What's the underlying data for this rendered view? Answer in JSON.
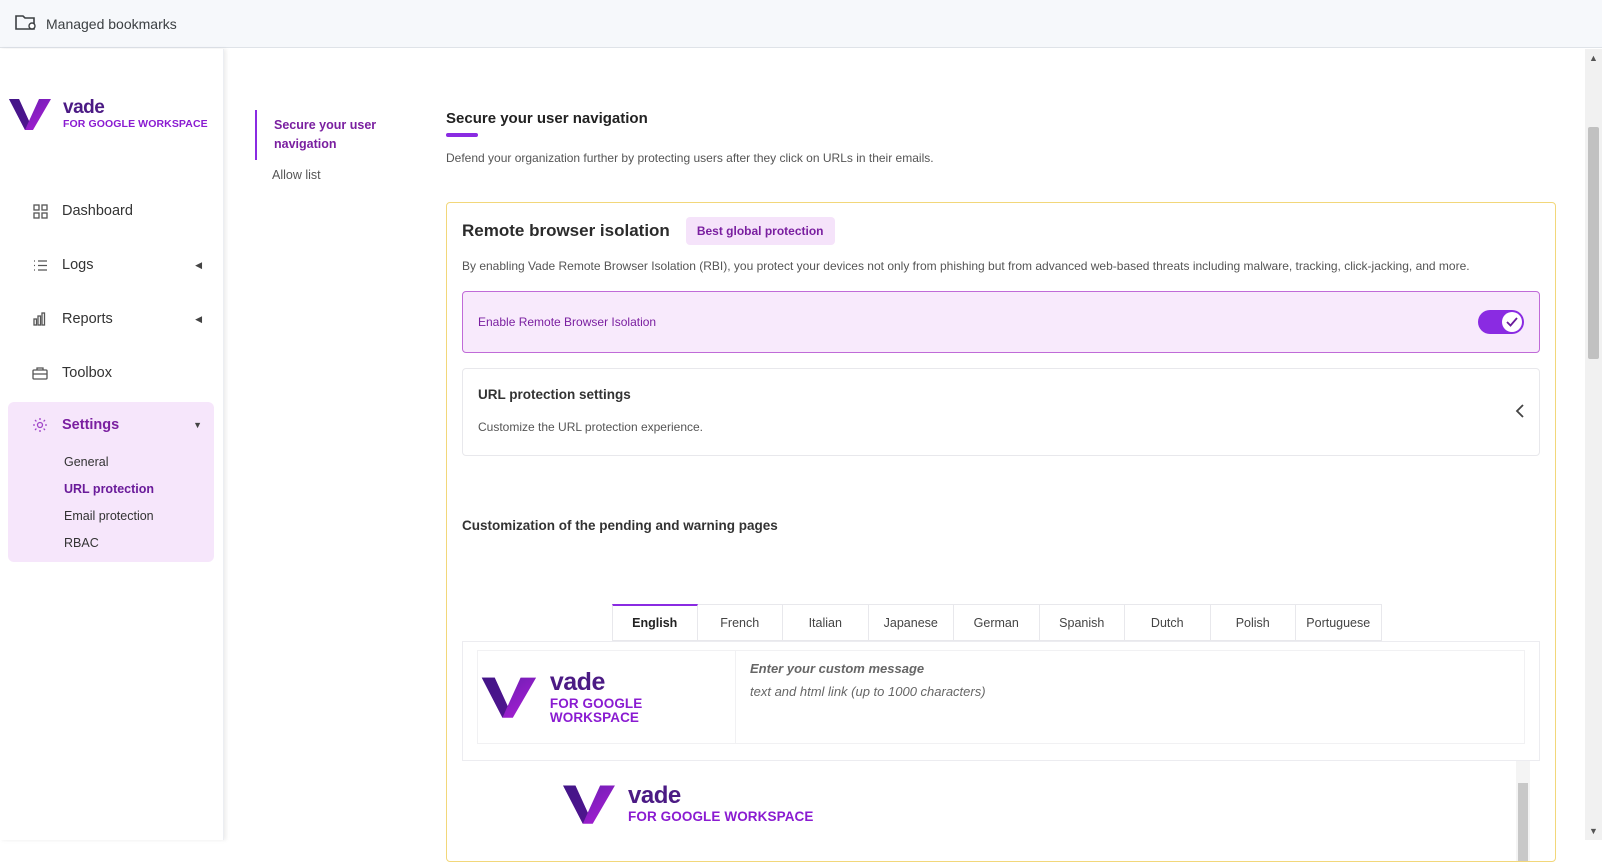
{
  "bookmarks_bar": {
    "managed_bookmarks": "Managed bookmarks"
  },
  "brand": {
    "name": "vade",
    "subtitle": "FOR GOOGLE WORKSPACE",
    "accent": "#8a2be2",
    "logo_color": "#4b1a84"
  },
  "sidebar": {
    "items": [
      {
        "label": "Dashboard",
        "icon": "grid-icon"
      },
      {
        "label": "Logs",
        "icon": "list-icon"
      },
      {
        "label": "Reports",
        "icon": "bar-chart-icon"
      },
      {
        "label": "Toolbox",
        "icon": "toolbox-icon"
      }
    ],
    "settings": {
      "label": "Settings",
      "icon": "gear-icon",
      "subitems": [
        "General",
        "URL protection",
        "Email protection",
        "RBAC"
      ],
      "active_subitem": "URL protection"
    }
  },
  "anchor_nav": {
    "items": [
      "Secure your user navigation",
      "Allow list"
    ],
    "active": "Secure your user navigation"
  },
  "main": {
    "title": "Secure your user navigation",
    "description": "Defend your organization further by protecting users after they click on URLs in their emails.",
    "rbi": {
      "title": "Remote browser isolation",
      "badge": "Best global protection",
      "description": "By enabling Vade Remote Browser Isolation (RBI), you protect your devices not only from phishing but from advanced web-based threats including malware, tracking, click-jacking, and more.",
      "toggle_label": "Enable Remote Browser Isolation",
      "toggle_on": true
    },
    "url_settings": {
      "title": "URL protection settings",
      "description": "Customize the URL protection experience."
    },
    "customization": {
      "title": "Customization of the pending and warning pages",
      "tabs": [
        "English",
        "French",
        "Italian",
        "Japanese",
        "German",
        "Spanish",
        "Dutch",
        "Polish",
        "Portuguese"
      ],
      "active_tab": "English",
      "message_placeholder": "Enter your custom message",
      "message_hint": "text and html link (up to 1000 characters)"
    }
  }
}
